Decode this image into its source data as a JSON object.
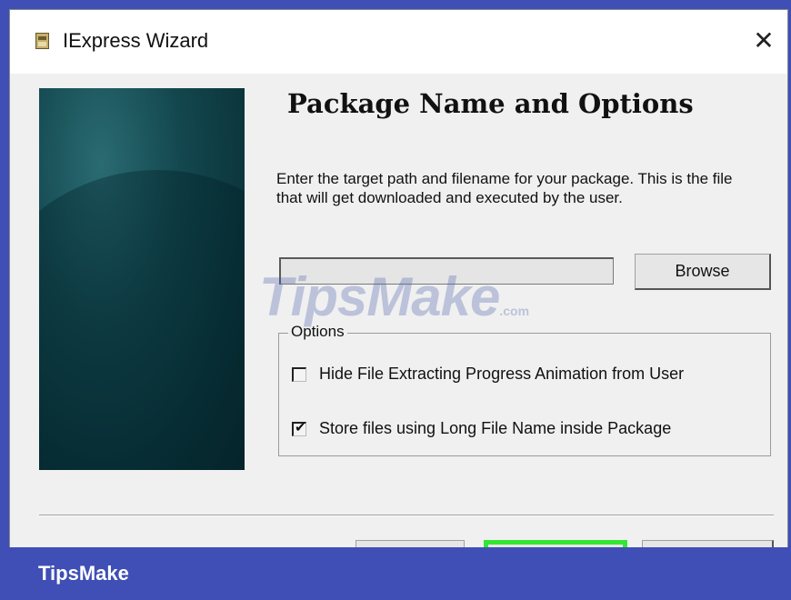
{
  "window": {
    "title": "IExpress Wizard",
    "close_glyph": "✕"
  },
  "page": {
    "heading": "Package Name and Options",
    "description": "Enter the target path and filename for your package. This is the file that will get downloaded and executed by the user."
  },
  "path_field": {
    "value": "",
    "browse_label": "Browse"
  },
  "options": {
    "legend": "Options",
    "items": [
      {
        "label": "Hide File Extracting Progress Animation from User",
        "checked": false
      },
      {
        "label": "Store files using Long File Name inside Package",
        "checked": true
      }
    ]
  },
  "watermark": {
    "text": "TipsMake",
    "suffix": ".com"
  },
  "brand": {
    "label": "TipsMake"
  },
  "colors": {
    "brand_blue": "#3f4fb5",
    "highlight_green": "#34e634"
  }
}
